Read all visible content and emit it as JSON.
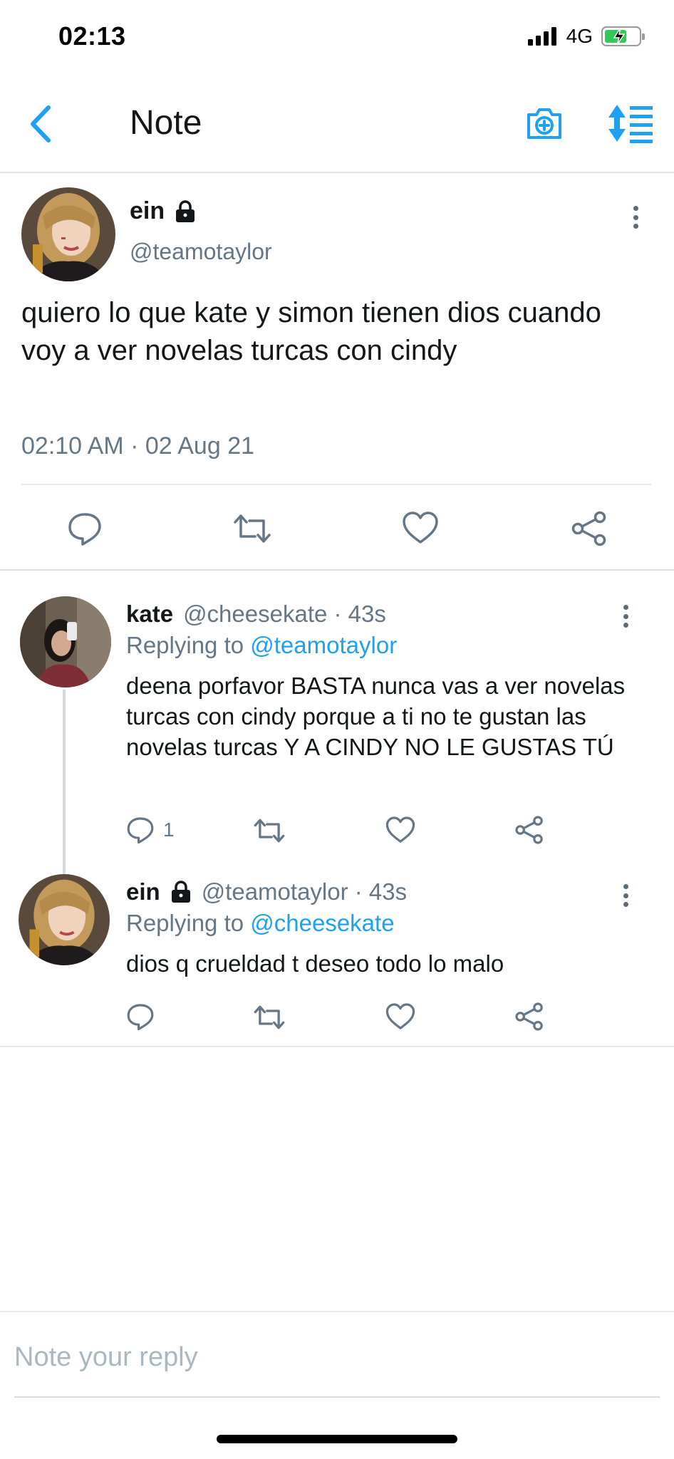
{
  "status": {
    "time": "02:13",
    "network": "4G"
  },
  "nav": {
    "title": "Note"
  },
  "tweet": {
    "name": "ein",
    "handle": "@teamotaylor",
    "text": "quiero lo que kate y simon tienen dios cuando voy a ver novelas turcas con cindy",
    "timestamp": "02:10 AM · 02 Aug 21"
  },
  "replies": [
    {
      "name": "kate",
      "meta": "@cheesekate · 43s",
      "replying_prefix": "Replying to ",
      "replying_to": "@teamotaylor",
      "text": "deena porfavor BASTA nunca vas a ver novelas turcas con cindy porque a ti no te gustan las novelas turcas Y A CINDY NO LE GUSTAS TÚ",
      "reply_count": "1"
    },
    {
      "name": "ein",
      "meta": "@teamotaylor · 43s",
      "replying_prefix": "Replying to ",
      "replying_to": "@cheesekate",
      "text": "dios q crueldad t deseo todo lo malo"
    }
  ],
  "compose": {
    "placeholder": "Note your reply"
  },
  "colors": {
    "accent": "#1da1f2",
    "secondary_text": "#657786",
    "battery": "#34c759"
  },
  "icons": [
    "back-icon",
    "camera-icon",
    "sort-icon",
    "lock-icon",
    "more-icon",
    "comment-icon",
    "retweet-icon",
    "heart-icon",
    "share-icon"
  ]
}
